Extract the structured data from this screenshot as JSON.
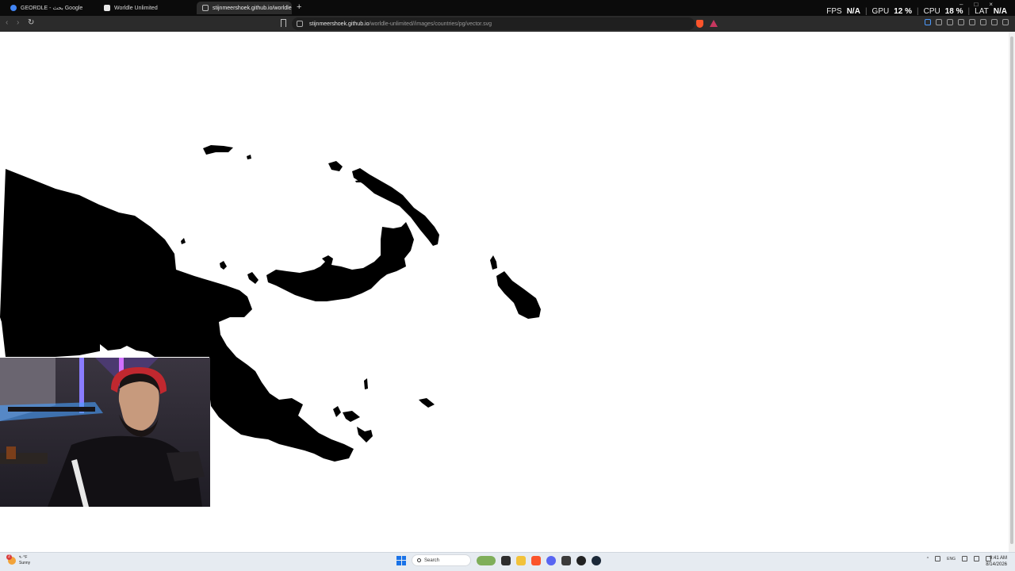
{
  "browser": {
    "tabs": [
      {
        "label": "GEORDLE - بحث Google",
        "active": false
      },
      {
        "label": "Worldle Unlimited",
        "active": false
      },
      {
        "label": "stijnmeershoek.github.io/worldle",
        "active": true
      }
    ],
    "new_tab": "+",
    "url": {
      "host": "stijnmeershoek.github.io",
      "path": "/worldle-unlimited//images/countries/pg/vector.svg"
    },
    "nav": {
      "back": "‹",
      "forward": "›",
      "reload": "↻"
    },
    "window_controls": {
      "minimize": "–",
      "maximize": "□",
      "close": "×"
    }
  },
  "stats_overlay": {
    "fps_label": "FPS",
    "fps_value": "N/A",
    "gpu_label": "GPU",
    "gpu_value": "12 %",
    "cpu_label": "CPU",
    "cpu_value": "18 %",
    "lat_label": "LAT",
    "lat_value": "N/A"
  },
  "content": {
    "map_country_code": "pg",
    "map_fill": "#000000"
  },
  "taskbar": {
    "weather_badge": "2",
    "weather_temp": "٩٠°F",
    "weather_desc": "Sunny",
    "search_placeholder": "Search",
    "lang": "ENG",
    "time": "9:41 AM",
    "date": "8/14/2026"
  }
}
